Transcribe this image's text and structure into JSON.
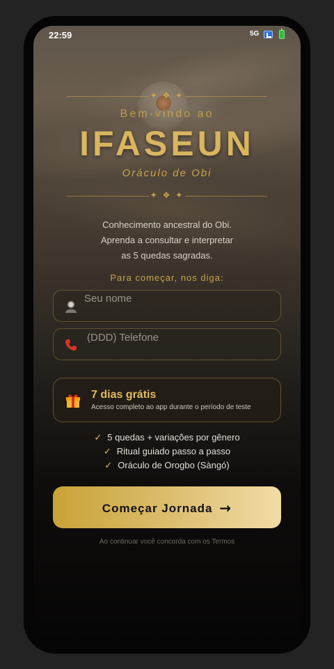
{
  "status_bar": {
    "time": "22:59",
    "network": "5G"
  },
  "header": {
    "ornament": "✦ ❖ ✦",
    "welcome": "Bem-vindo ao",
    "brand": "IFASEUN",
    "subtitle": "Oráculo de Obi"
  },
  "intro": {
    "line1": "Conhecimento ancestral do Obi.",
    "line2": "Aprenda a consultar e interpretar",
    "line3": "as 5 quedas sagradas.",
    "prompt": "Para começar, nos diga:"
  },
  "form": {
    "name": {
      "placeholder": "Seu nome",
      "value": ""
    },
    "phone": {
      "placeholder": "(DDD) Telefone",
      "value": ""
    }
  },
  "trial": {
    "title": "7 dias grátis",
    "subtitle": "Acesso completo ao app durante o período de teste"
  },
  "features": [
    "5 quedas + variações por gênero",
    "Ritual guiado passo a passo",
    "Oráculo de Orogbo (Sàngó)"
  ],
  "cta": {
    "label": "Começar Jornada",
    "arrow": "→"
  },
  "terms": "Ao continuar você concorda com os Termos",
  "colors": {
    "accent": "#c9a44c",
    "brand": "#d9b560",
    "background": "#0f0d0c"
  }
}
